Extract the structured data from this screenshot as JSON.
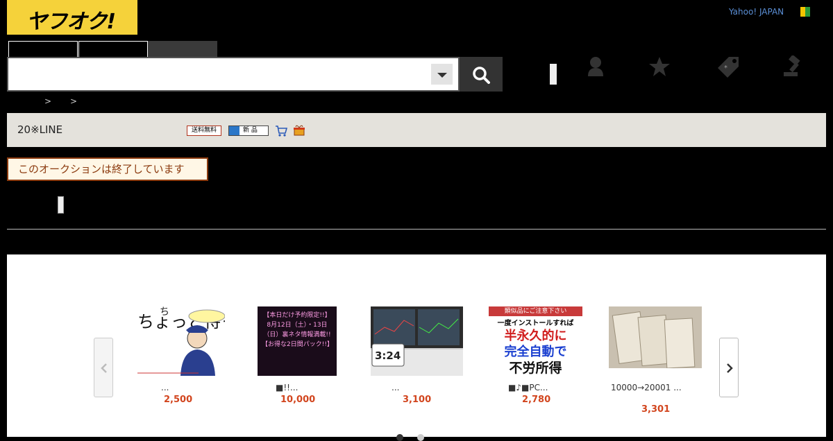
{
  "header": {
    "logo_text": "ヤフオク!",
    "yahoo_link": "Yahoo! JAPAN"
  },
  "search": {
    "value": "",
    "placeholder": ""
  },
  "nav_icons": [
    "user-icon",
    "star-icon",
    "tag-icon",
    "gavel-icon"
  ],
  "breadcrumb": [
    "",
    "",
    ""
  ],
  "info_bar": {
    "title": "20※LINE",
    "free_shipping_badge": "送料無料",
    "new_badge": "新 品"
  },
  "auction_status": "このオークションは終了しています",
  "recommendations": {
    "items": [
      {
        "title": "...",
        "price": "2,500",
        "image_text": "ちょっと待った"
      },
      {
        "title": "■!!...",
        "price": "10,000",
        "image_text": "【本日だけ予約限定!!】8月12日（土）・13日（日）裏ネタ情報満載!!【お得な2日間パック!!】"
      },
      {
        "title": "...",
        "price": "3,100",
        "image_text": "3:24"
      },
      {
        "title": "■♪■PC...",
        "price": "2,780",
        "image_text": "類似品にご注意下さい 一度インストールすれば 半永久的に 完全自動で 不労所得"
      },
      {
        "title": "10000→20001 ...",
        "price": "3,301",
        "image_text": ""
      }
    ]
  },
  "colors": {
    "logo_bg": "#f5d23a",
    "price": "#d2451e",
    "ended_border": "#8b3a0e",
    "info_bar_bg": "#e4e2dc"
  }
}
